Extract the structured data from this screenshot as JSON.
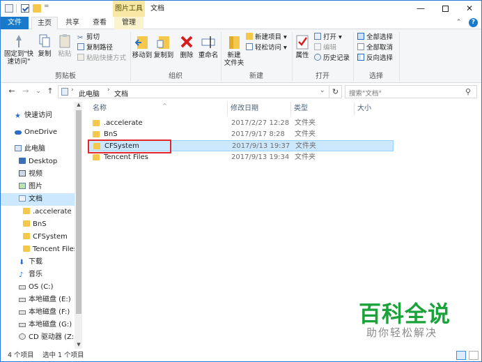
{
  "window": {
    "title": "文档",
    "context_group": "图片工具",
    "buttons": {
      "minimize": "—",
      "maximize": "",
      "close": "✕"
    }
  },
  "quick_access": {
    "dropdown": "="
  },
  "tabs": {
    "file": "文件",
    "home": "主页",
    "share": "共享",
    "view": "查看",
    "manage": "管理",
    "collapse": "⌃",
    "help": "?"
  },
  "ribbon": {
    "clipboard": {
      "label": "剪贴板",
      "pin": "固定到\"快速访问\"",
      "copy": "复制",
      "paste": "粘贴",
      "cut": "剪切",
      "copy_path": "复制路径",
      "paste_shortcut": "粘贴快捷方式"
    },
    "organize": {
      "label": "组织",
      "move_to": "移动到",
      "copy_to": "复制到",
      "delete": "删除",
      "rename": "重命名"
    },
    "new": {
      "label": "新建",
      "new_folder": "新建\n文件夹",
      "new_item": "新建项目 ▾",
      "easy_access": "轻松访问 ▾"
    },
    "open": {
      "label": "打开",
      "properties": "属性",
      "open": "打开 ▾",
      "edit": "编辑",
      "history": "历史记录"
    },
    "select": {
      "label": "选择",
      "select_all": "全部选择",
      "select_none": "全部取消",
      "invert": "反向选择"
    }
  },
  "nav": {
    "back": "←",
    "forward": "→",
    "recent": "⌄",
    "up": "↑",
    "breadcrumb": [
      "此电脑",
      "文档"
    ],
    "crumb_sep": "›",
    "address_dropdown": "⌄",
    "refresh": "↻",
    "search_placeholder": "搜索\"文档\"",
    "search_icon": "⚲"
  },
  "sidebar": {
    "items": [
      {
        "label": "快速访问",
        "icon": "star-icon"
      },
      {
        "label": "OneDrive",
        "icon": "cloud-icon"
      },
      {
        "label": "此电脑",
        "icon": "computer-icon"
      },
      {
        "label": "Desktop",
        "icon": "folder-icon"
      },
      {
        "label": "视频",
        "icon": "video-icon"
      },
      {
        "label": "图片",
        "icon": "pictures-icon"
      },
      {
        "label": "文档",
        "icon": "documents-icon"
      },
      {
        "label": ".accelerate",
        "icon": "folder-icon"
      },
      {
        "label": "BnS",
        "icon": "folder-icon"
      },
      {
        "label": "CFSystem",
        "icon": "folder-icon"
      },
      {
        "label": "Tencent Files",
        "icon": "folder-icon"
      },
      {
        "label": "下载",
        "icon": "download-icon"
      },
      {
        "label": "音乐",
        "icon": "music-icon"
      },
      {
        "label": "OS (C:)",
        "icon": "drive-icon"
      },
      {
        "label": "本地磁盘 (E:)",
        "icon": "drive-icon"
      },
      {
        "label": "本地磁盘 (F:)",
        "icon": "drive-icon"
      },
      {
        "label": "本地磁盘 (G:)",
        "icon": "drive-icon"
      },
      {
        "label": "CD 驱动器 (Z:)",
        "icon": "cd-drive-icon"
      }
    ],
    "selected": "文档",
    "scroll_up": "▲",
    "scroll_down": "▼"
  },
  "columns": {
    "name": "名称",
    "modified": "修改日期",
    "type": "类型",
    "size": "大小",
    "sort_arrow": "^"
  },
  "files": [
    {
      "name": ".accelerate",
      "modified": "2017/2/27 12:28",
      "type": "文件夹",
      "size": ""
    },
    {
      "name": "BnS",
      "modified": "2017/9/17 8:28",
      "type": "文件夹",
      "size": ""
    },
    {
      "name": "CFSystem",
      "modified": "2017/9/13 19:37",
      "type": "文件夹",
      "size": ""
    },
    {
      "name": "Tencent Files",
      "modified": "2017/9/13 19:34",
      "type": "文件夹",
      "size": ""
    }
  ],
  "selected_file": "CFSystem",
  "highlight_color": "#e2262a",
  "status": {
    "count": "4 个项目",
    "selection": "选中 1 个项目"
  },
  "watermark": {
    "title": "百科全说",
    "subtitle": "助你轻松解决"
  },
  "colors": {
    "accent": "#1979ca",
    "selection": "#cce8ff",
    "watermark": "#1aa33a",
    "folder": "#f5c84c"
  }
}
